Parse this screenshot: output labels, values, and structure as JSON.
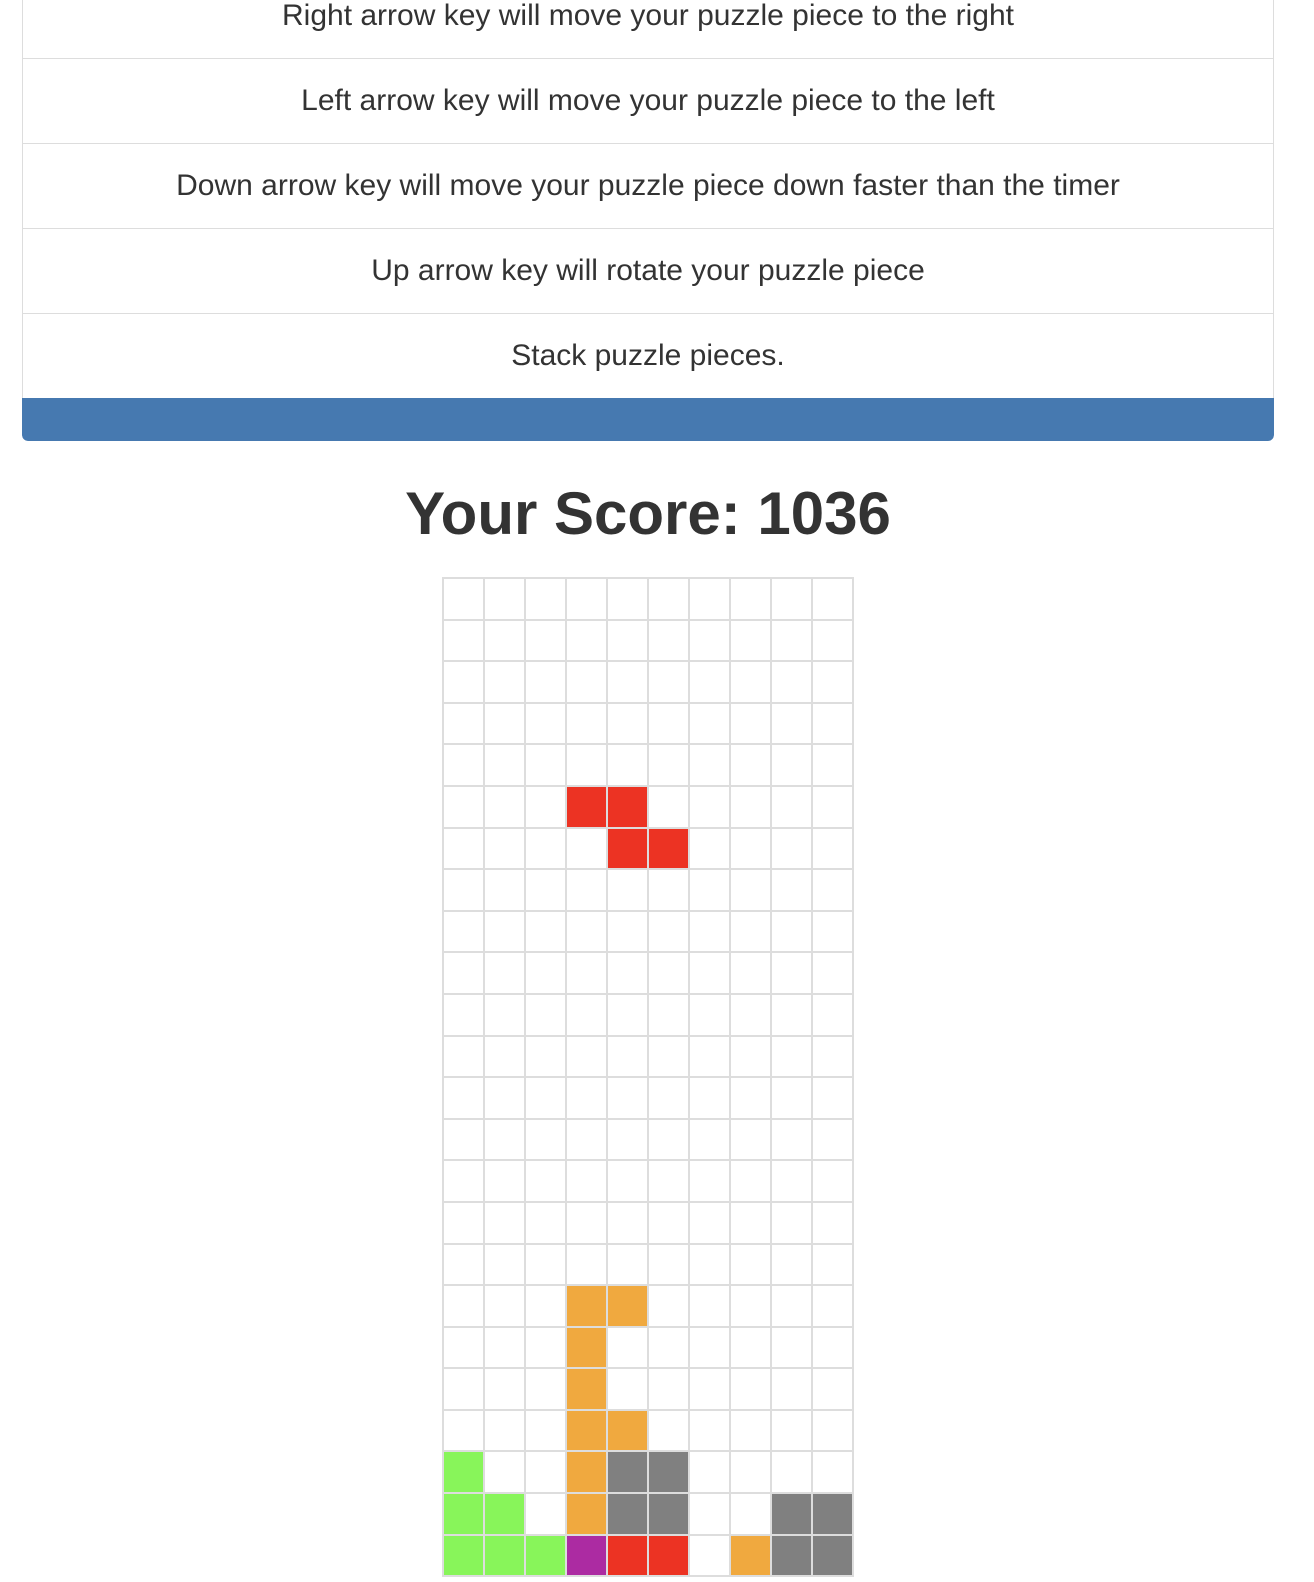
{
  "instructions": {
    "items": [
      "Right arrow key will move your puzzle piece to the right",
      "Left arrow key will move your puzzle piece to the left",
      "Down arrow key will move your puzzle piece down faster than the timer",
      "Up arrow key will rotate your puzzle piece",
      "Stack puzzle pieces."
    ]
  },
  "score": {
    "label": "Your Score: 1036",
    "value": 1036
  },
  "board": {
    "columns": 10,
    "rows": 24,
    "colors": {
      "empty": "#ffffff",
      "red": "#ec3323",
      "orange": "#f0a93f",
      "gray": "#808080",
      "green": "#88f55a",
      "purple": "#ac2ba2",
      "grid_line": "#dddddd"
    },
    "active_piece": {
      "type": "Z",
      "color": "red"
    },
    "cells": [
      [
        null,
        null,
        null,
        null,
        null,
        null,
        null,
        null,
        null,
        null
      ],
      [
        null,
        null,
        null,
        null,
        null,
        null,
        null,
        null,
        null,
        null
      ],
      [
        null,
        null,
        null,
        null,
        null,
        null,
        null,
        null,
        null,
        null
      ],
      [
        null,
        null,
        null,
        null,
        null,
        null,
        null,
        null,
        null,
        null
      ],
      [
        null,
        null,
        null,
        null,
        null,
        null,
        null,
        null,
        null,
        null
      ],
      [
        null,
        null,
        null,
        "red",
        "red",
        null,
        null,
        null,
        null,
        null
      ],
      [
        null,
        null,
        null,
        null,
        "red",
        "red",
        null,
        null,
        null,
        null
      ],
      [
        null,
        null,
        null,
        null,
        null,
        null,
        null,
        null,
        null,
        null
      ],
      [
        null,
        null,
        null,
        null,
        null,
        null,
        null,
        null,
        null,
        null
      ],
      [
        null,
        null,
        null,
        null,
        null,
        null,
        null,
        null,
        null,
        null
      ],
      [
        null,
        null,
        null,
        null,
        null,
        null,
        null,
        null,
        null,
        null
      ],
      [
        null,
        null,
        null,
        null,
        null,
        null,
        null,
        null,
        null,
        null
      ],
      [
        null,
        null,
        null,
        null,
        null,
        null,
        null,
        null,
        null,
        null
      ],
      [
        null,
        null,
        null,
        null,
        null,
        null,
        null,
        null,
        null,
        null
      ],
      [
        null,
        null,
        null,
        null,
        null,
        null,
        null,
        null,
        null,
        null
      ],
      [
        null,
        null,
        null,
        null,
        null,
        null,
        null,
        null,
        null,
        null
      ],
      [
        null,
        null,
        null,
        null,
        null,
        null,
        null,
        null,
        null,
        null
      ],
      [
        null,
        null,
        null,
        "orange",
        "orange",
        null,
        null,
        null,
        null,
        null
      ],
      [
        null,
        null,
        null,
        "orange",
        null,
        null,
        null,
        null,
        null,
        null
      ],
      [
        null,
        null,
        null,
        "orange",
        null,
        null,
        null,
        null,
        null,
        null
      ],
      [
        null,
        null,
        null,
        "orange",
        "orange",
        null,
        null,
        null,
        null,
        null
      ],
      [
        "green",
        null,
        null,
        "orange",
        "gray",
        "gray",
        null,
        null,
        null,
        null
      ],
      [
        "green",
        "green",
        null,
        "orange",
        "gray",
        "gray",
        null,
        null,
        "gray",
        "gray"
      ],
      [
        "green",
        "green",
        "green",
        "purple",
        "red",
        "red",
        null,
        "orange",
        "gray",
        "gray"
      ]
    ]
  }
}
